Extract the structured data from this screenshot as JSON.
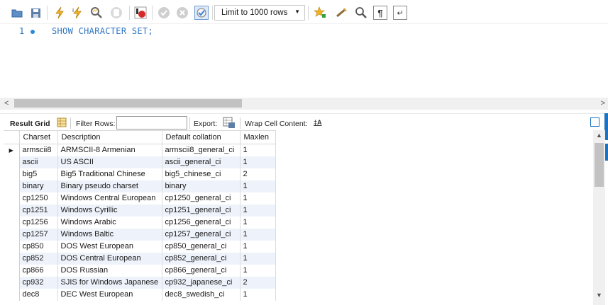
{
  "toolbar": {
    "icons": [
      "open-file-icon",
      "save-icon",
      "execute-icon",
      "execute-current-icon",
      "explain-icon",
      "stop-icon",
      "toggle-stop-on-error-icon",
      "commit-icon",
      "rollback-icon",
      "autocommit-icon",
      "add-snippet-icon",
      "beautify-icon",
      "find-icon",
      "invisible-chars-icon",
      "wrap-lines-icon"
    ],
    "limit_label": "Limit to 1000 rows"
  },
  "editor": {
    "line_number": "1",
    "code": "SHOW CHARACTER SET;"
  },
  "result_toolbar": {
    "result_grid_label": "Result Grid",
    "filter_rows_label": "Filter Rows:",
    "filter_value": "",
    "export_label": "Export:",
    "wrap_label": "Wrap Cell Content:"
  },
  "grid": {
    "columns": [
      "Charset",
      "Description",
      "Default collation",
      "Maxlen"
    ],
    "rows": [
      [
        "armscii8",
        "ARMSCII-8 Armenian",
        "armscii8_general_ci",
        "1"
      ],
      [
        "ascii",
        "US ASCII",
        "ascii_general_ci",
        "1"
      ],
      [
        "big5",
        "Big5 Traditional Chinese",
        "big5_chinese_ci",
        "2"
      ],
      [
        "binary",
        "Binary pseudo charset",
        "binary",
        "1"
      ],
      [
        "cp1250",
        "Windows Central European",
        "cp1250_general_ci",
        "1"
      ],
      [
        "cp1251",
        "Windows Cyrillic",
        "cp1251_general_ci",
        "1"
      ],
      [
        "cp1256",
        "Windows Arabic",
        "cp1256_general_ci",
        "1"
      ],
      [
        "cp1257",
        "Windows Baltic",
        "cp1257_general_ci",
        "1"
      ],
      [
        "cp850",
        "DOS West European",
        "cp850_general_ci",
        "1"
      ],
      [
        "cp852",
        "DOS Central European",
        "cp852_general_ci",
        "1"
      ],
      [
        "cp866",
        "DOS Russian",
        "cp866_general_ci",
        "1"
      ],
      [
        "cp932",
        "SJIS for Windows Japanese",
        "cp932_japanese_ci",
        "2"
      ],
      [
        "dec8",
        "DEC West European",
        "dec8_swedish_ci",
        "1"
      ]
    ]
  },
  "colors": {
    "accent": "#1b73c4",
    "row_alt": "#eef3fb",
    "code": "#2f76c4"
  }
}
